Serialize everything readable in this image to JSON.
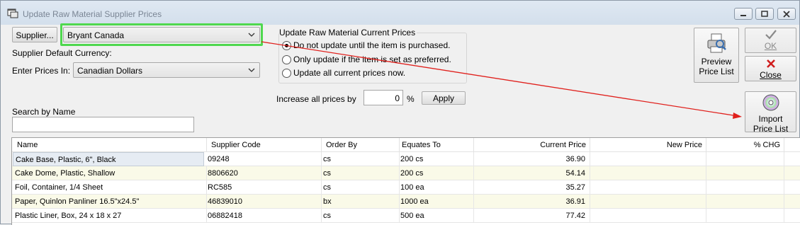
{
  "window": {
    "title": "Update Raw Material Supplier Prices"
  },
  "supplier": {
    "button_label": "Supplier...",
    "selected": "Bryant Canada"
  },
  "currency": {
    "default_label": "Supplier Default Currency:",
    "enter_label": "Enter Prices In:",
    "selected": "Canadian Dollars"
  },
  "update_group": {
    "title": "Update Raw Material Current Prices",
    "options": [
      {
        "label": "Do not update until the item is purchased.",
        "selected": true
      },
      {
        "label": "Only update if the item is set as preferred.",
        "selected": false
      },
      {
        "label": "Update all current prices now.",
        "selected": false
      }
    ]
  },
  "increase": {
    "label": "Increase all prices by",
    "value": "0",
    "unit": "%",
    "apply_label": "Apply"
  },
  "search": {
    "label": "Search by Name",
    "value": ""
  },
  "actions": {
    "preview_label_1": "Preview",
    "preview_label_2": "Price List",
    "ok_label": "OK",
    "close_label": "Close",
    "import_label_1": "Import",
    "import_label_2": "Price List"
  },
  "table": {
    "columns": [
      "Name",
      "Supplier Code",
      "Order By",
      "Equates To",
      "Current Price",
      "New Price",
      "% CHG"
    ],
    "rows": [
      {
        "name": "Cake Base, Plastic, 6\", Black",
        "code": "09248",
        "order_by": "cs",
        "equates": "200 cs",
        "current": "36.90",
        "new": "",
        "chg": ""
      },
      {
        "name": "Cake Dome, Plastic, Shallow",
        "code": "8806620",
        "order_by": "cs",
        "equates": "200 cs",
        "current": "54.14",
        "new": "",
        "chg": ""
      },
      {
        "name": "Foil, Container, 1/4 Sheet",
        "code": "RC585",
        "order_by": "cs",
        "equates": "100 ea",
        "current": "35.27",
        "new": "",
        "chg": ""
      },
      {
        "name": "Paper, Quinlon Panliner 16.5\"x24.5\"",
        "code": "46839010",
        "order_by": "bx",
        "equates": "1000 ea",
        "current": "36.91",
        "new": "",
        "chg": ""
      },
      {
        "name": "Plastic Liner, Box, 24 x 18 x 27",
        "code": "06882418",
        "order_by": "cs",
        "equates": "500 ea",
        "current": "77.42",
        "new": "",
        "chg": ""
      }
    ]
  },
  "colors": {
    "highlight": "#4fd84f",
    "arrow": "#e0201c"
  },
  "icons": {
    "title": "window-icon",
    "preview": "printer-icon",
    "ok": "checkmark-icon",
    "close": "red-x-icon",
    "import": "cd-disc-icon"
  }
}
